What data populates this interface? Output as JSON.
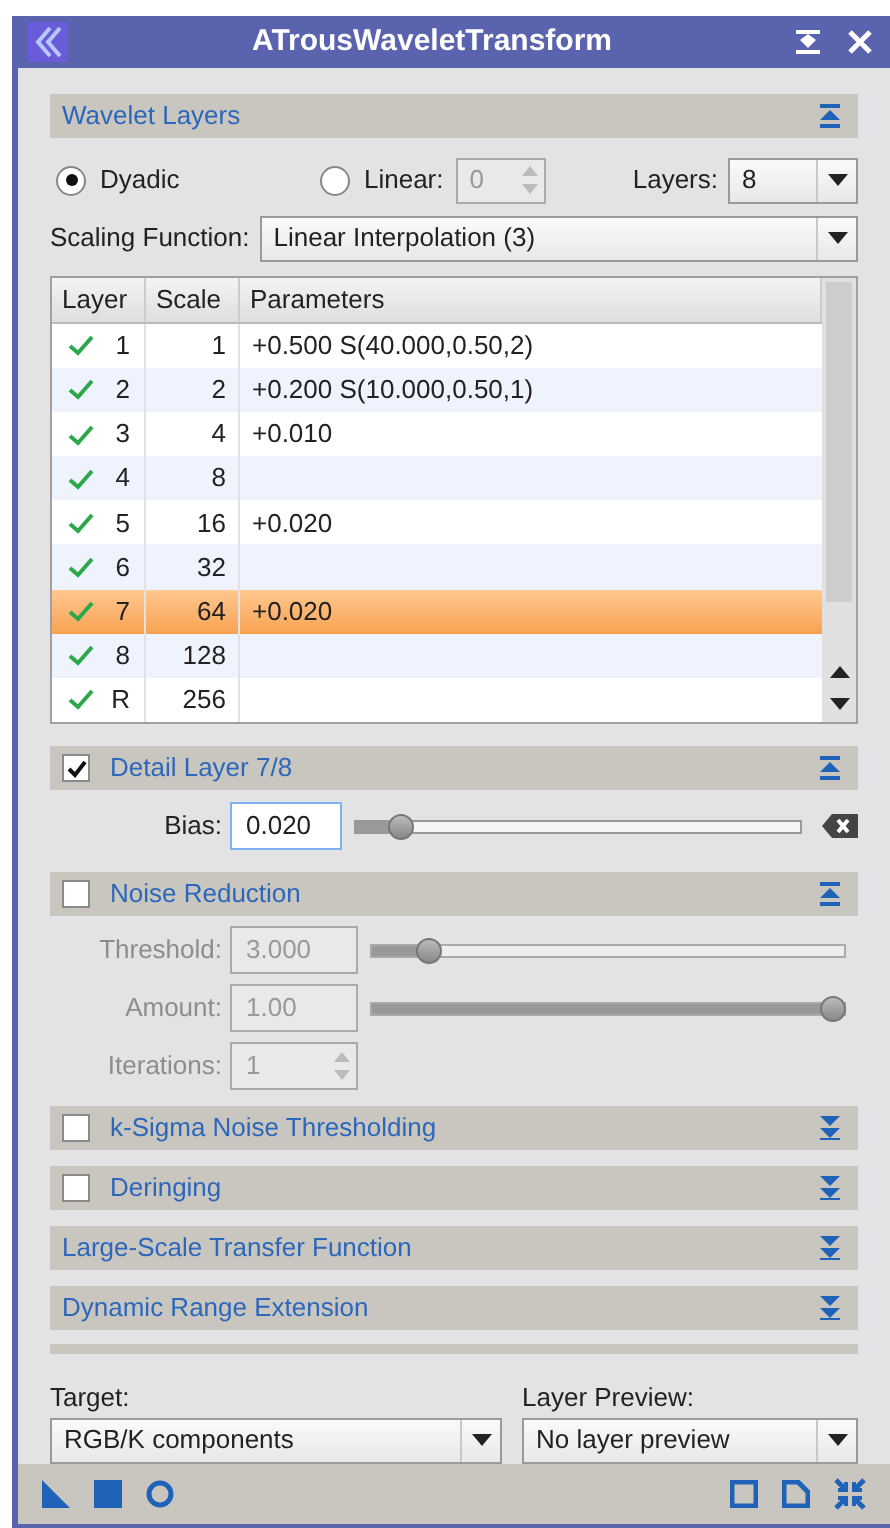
{
  "window": {
    "title": "ATrousWaveletTransform"
  },
  "wavelet_layers": {
    "title": "Wavelet Layers",
    "expanded": true,
    "dyadic": {
      "label": "Dyadic",
      "selected": true
    },
    "linear": {
      "label": "Linear:",
      "selected": false,
      "value": "0"
    },
    "layers": {
      "label": "Layers:",
      "value": "8"
    },
    "scaling_function": {
      "label": "Scaling Function:",
      "value": "Linear Interpolation (3)"
    },
    "table": {
      "columns": [
        "Layer",
        "Scale",
        "Parameters"
      ],
      "rows": [
        {
          "enabled": true,
          "layer": "1",
          "scale": "1",
          "parameters": "+0.500 S(40.000,0.50,2)",
          "selected": false
        },
        {
          "enabled": true,
          "layer": "2",
          "scale": "2",
          "parameters": "+0.200 S(10.000,0.50,1)",
          "selected": false
        },
        {
          "enabled": true,
          "layer": "3",
          "scale": "4",
          "parameters": "+0.010",
          "selected": false
        },
        {
          "enabled": true,
          "layer": "4",
          "scale": "8",
          "selected": false
        },
        {
          "enabled": true,
          "layer": "5",
          "scale": "16",
          "parameters": "+0.020",
          "selected": false
        },
        {
          "enabled": true,
          "layer": "6",
          "scale": "32",
          "selected": false
        },
        {
          "enabled": true,
          "layer": "7",
          "scale": "64",
          "parameters": "+0.020",
          "selected": true
        },
        {
          "enabled": true,
          "layer": "8",
          "scale": "128",
          "selected": false
        },
        {
          "enabled": true,
          "layer": "R",
          "scale": "256",
          "selected": false
        }
      ]
    }
  },
  "detail_layer": {
    "title": "Detail Layer 7/8",
    "checked": true,
    "expanded": true,
    "bias": {
      "label": "Bias:",
      "value": "0.020",
      "level": 0.08
    }
  },
  "noise_reduction": {
    "title": "Noise Reduction",
    "checked": false,
    "expanded": true,
    "threshold": {
      "label": "Threshold:",
      "value": "3.000",
      "level": 0.1
    },
    "amount": {
      "label": "Amount:",
      "value": "1.00",
      "level": 1
    },
    "iterations": {
      "label": "Iterations:",
      "value": "1"
    }
  },
  "collapsed_sections": [
    {
      "title": "k-Sigma Noise Thresholding",
      "kind": "checkable",
      "checked": false,
      "expanded": false
    },
    {
      "title": "Deringing",
      "kind": "checkable",
      "checked": false,
      "expanded": false
    },
    {
      "title": "Large-Scale Transfer Function",
      "kind": "plain",
      "expanded": false
    },
    {
      "title": "Dynamic Range Extension",
      "kind": "plain",
      "expanded": false
    }
  ],
  "target": {
    "label": "Target:",
    "value": "RGB/K components"
  },
  "layer_preview": {
    "label": "Layer Preview:",
    "value": "No layer preview"
  }
}
